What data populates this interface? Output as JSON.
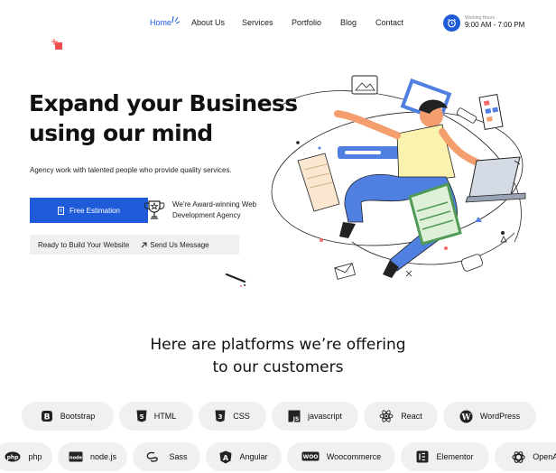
{
  "nav": {
    "items": [
      {
        "label": "Home",
        "active": true
      },
      {
        "label": "About Us",
        "active": false
      },
      {
        "label": "Services",
        "active": false
      },
      {
        "label": "Portfolio",
        "active": false
      },
      {
        "label": "Blog",
        "active": false
      },
      {
        "label": "Contact",
        "active": false
      }
    ]
  },
  "hours": {
    "label": "Working Hours",
    "value": "9:00 AM - 7:00 PM",
    "icon": "alarm-clock-icon"
  },
  "hero": {
    "title_line1": "Expand your Business",
    "title_line2": "using our mind",
    "subtitle": "Agency work with talented people who provide quality services.",
    "primary_button": "Free Estimation",
    "award_text": "We're Award-winning Web Development Agency",
    "cta_left": "Ready to Build Your Website",
    "cta_right": "Send Us Message"
  },
  "platforms": {
    "title_line1": "Here are platforms we’re offering",
    "title_line2": "to our customers",
    "row1": [
      {
        "label": "Bootstrap",
        "icon": "bootstrap-icon"
      },
      {
        "label": "HTML",
        "icon": "html5-icon"
      },
      {
        "label": "CSS",
        "icon": "css3-icon"
      },
      {
        "label": "javascript",
        "icon": "javascript-icon"
      },
      {
        "label": "React",
        "icon": "react-icon"
      },
      {
        "label": "WordPress",
        "icon": "wordpress-icon"
      }
    ],
    "row2": [
      {
        "label": "php",
        "icon": "php-icon"
      },
      {
        "label": "node.js",
        "icon": "nodejs-icon"
      },
      {
        "label": "Sass",
        "icon": "sass-icon"
      },
      {
        "label": "Angular",
        "icon": "angular-icon"
      },
      {
        "label": "Woocommerce",
        "icon": "woocommerce-icon"
      },
      {
        "label": "Elementor",
        "icon": "elementor-icon"
      },
      {
        "label": "OpenAI",
        "icon": "openai-icon"
      }
    ]
  },
  "colors": {
    "accent": "#1f5bd8",
    "chip_bg": "#f0f0f0",
    "illus_blue": "#4f7fe0",
    "illus_yellow": "#fbf2b0",
    "illus_orange": "#f49e6e"
  }
}
